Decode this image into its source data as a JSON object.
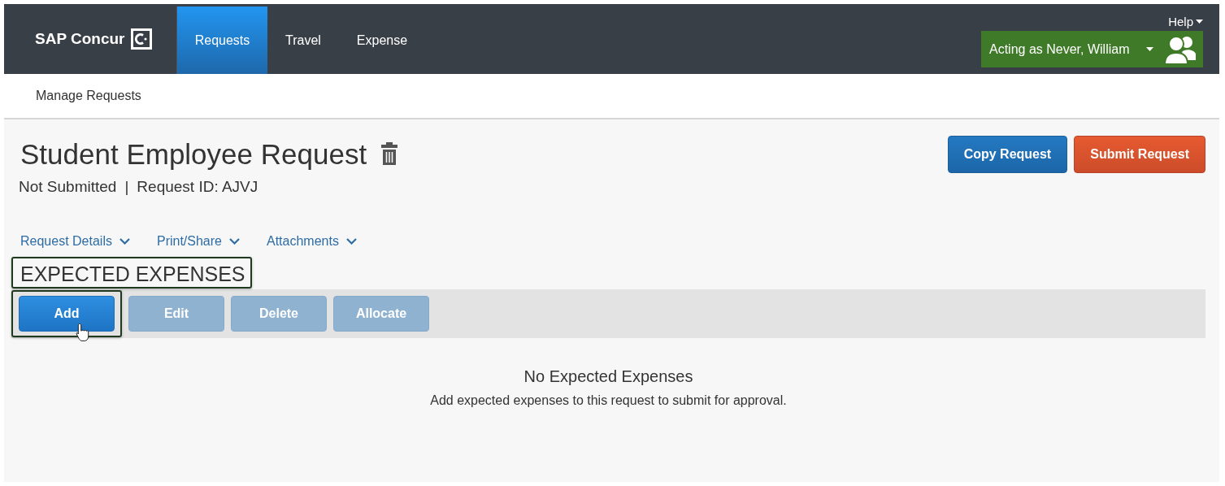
{
  "header": {
    "logo": "SAP Concur",
    "tabs": [
      {
        "label": "Requests",
        "selected": true
      },
      {
        "label": "Travel",
        "selected": false
      },
      {
        "label": "Expense",
        "selected": false
      }
    ],
    "help": "Help",
    "acting_as": "Acting as Never, William"
  },
  "subnav": {
    "label": "Manage Requests"
  },
  "request": {
    "title": "Student Employee Request",
    "status": "Not Submitted",
    "separator": "|",
    "request_id": "Request ID: AJVJ",
    "actions": [
      {
        "label": "Copy Request",
        "kind": "primary"
      },
      {
        "label": "Submit Request",
        "kind": "submit"
      }
    ],
    "menus": [
      "Request Details",
      "Print/Share",
      "Attachments"
    ]
  },
  "expenses": {
    "heading": "EXPECTED EXPENSES",
    "highlighted": true,
    "toolbar": [
      {
        "label": "Add",
        "disabled": false,
        "highlighted": true
      },
      {
        "label": "Edit",
        "disabled": true,
        "highlighted": false
      },
      {
        "label": "Delete",
        "disabled": true,
        "highlighted": false
      },
      {
        "label": "Allocate",
        "disabled": true,
        "highlighted": false
      }
    ],
    "empty_title": "No Expected Expenses",
    "empty_text": "Add expected expenses to this request to submit for approval."
  }
}
